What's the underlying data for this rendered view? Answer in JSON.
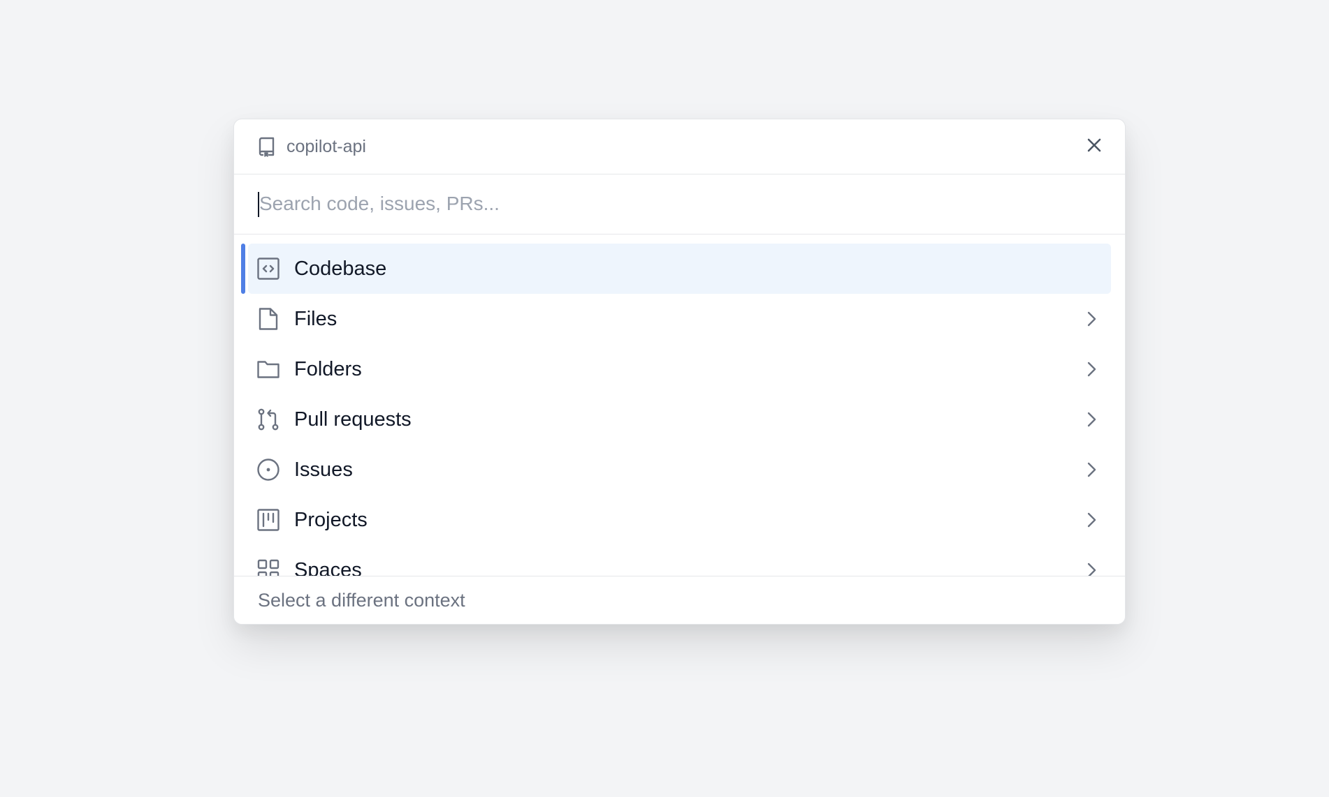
{
  "header": {
    "repo_name": "copilot-api",
    "repo_icon": "repo-icon",
    "close_icon": "close-icon"
  },
  "search": {
    "value": "",
    "placeholder": "Search code, issues, PRs..."
  },
  "menu": {
    "selected_index": 0,
    "accent_color": "#4f7fe5",
    "selected_bg": "#eef5fd",
    "items": [
      {
        "label": "Codebase",
        "icon": "code-square-icon",
        "has_chevron": false
      },
      {
        "label": "Files",
        "icon": "file-icon",
        "has_chevron": true
      },
      {
        "label": "Folders",
        "icon": "folder-icon",
        "has_chevron": true
      },
      {
        "label": "Pull requests",
        "icon": "pull-request-icon",
        "has_chevron": true
      },
      {
        "label": "Issues",
        "icon": "issue-icon",
        "has_chevron": true
      },
      {
        "label": "Projects",
        "icon": "project-icon",
        "has_chevron": true
      },
      {
        "label": "Spaces",
        "icon": "spaces-icon",
        "has_chevron": true
      }
    ]
  },
  "footer": {
    "hint": "Select a different context"
  }
}
